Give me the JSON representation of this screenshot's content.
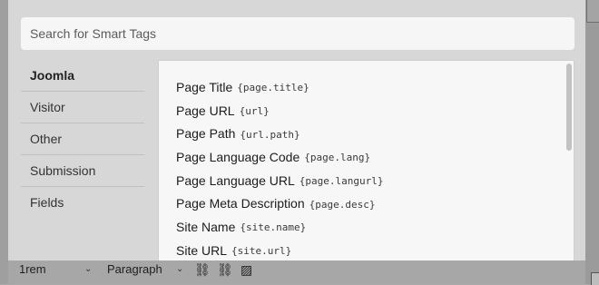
{
  "search": {
    "placeholder": "Search for Smart Tags"
  },
  "categories": [
    {
      "label": "Joomla",
      "active": true
    },
    {
      "label": "Visitor",
      "active": false
    },
    {
      "label": "Other",
      "active": false
    },
    {
      "label": "Submission",
      "active": false
    },
    {
      "label": "Fields",
      "active": false
    }
  ],
  "tags": [
    {
      "name": "Page Title",
      "code": "{page.title}"
    },
    {
      "name": "Page URL",
      "code": "{url}"
    },
    {
      "name": "Page Path",
      "code": "{url.path}"
    },
    {
      "name": "Page Language Code",
      "code": "{page.lang}"
    },
    {
      "name": "Page Language URL",
      "code": "{page.langurl}"
    },
    {
      "name": "Page Meta Description",
      "code": "{page.desc}"
    },
    {
      "name": "Site Name",
      "code": "{site.name}"
    },
    {
      "name": "Site URL",
      "code": "{site.url}"
    }
  ],
  "background_toolbar": {
    "font_size": "1rem",
    "format": "Paragraph"
  }
}
